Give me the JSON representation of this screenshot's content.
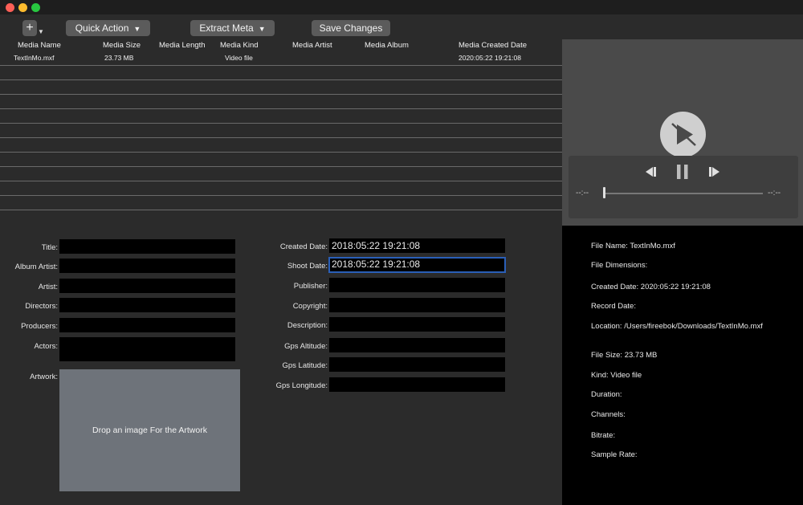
{
  "toolbar": {
    "add_label": "+",
    "quick_action": "Quick Action",
    "extract_meta": "Extract Meta",
    "save_changes": "Save Changes"
  },
  "table": {
    "columns": [
      "Media Name",
      "Media Size",
      "Media Length",
      "Media Kind",
      "Media Artist",
      "Media Album",
      "Media Created Date"
    ],
    "rows": [
      {
        "name": "TextInMo.mxf",
        "size": "23.73 MB",
        "length": "",
        "kind": "Video file",
        "artist": "",
        "album": "",
        "created": "2020:05:22 19:21:08"
      }
    ]
  },
  "player": {
    "time_elapsed": "--:--",
    "time_remaining": "--:--",
    "progress": 0
  },
  "form": {
    "title_label": "Title:",
    "album_artist_label": "Album Artist:",
    "artist_label": "Artist:",
    "directors_label": "Directors:",
    "producers_label": "Producers:",
    "actors_label": "Actors:",
    "artwork_label": "Artwork:",
    "artwork_hint": "Drop an image For the Artwork",
    "created_date_label": "Created Date:",
    "created_date_value": "2018:05:22 19:21:08",
    "shoot_date_label": "Shoot Date:",
    "shoot_date_value": "2018:05:22 19:21:08",
    "publisher_label": "Publisher:",
    "copyright_label": "Copyright:",
    "description_label": "Description:",
    "gps_altitude_label": "Gps Altitude:",
    "gps_latitude_label": "Gps Latitude:",
    "gps_longitude_label": "Gps Longitude:"
  },
  "info": {
    "file_name": "File Name: TextInMo.mxf",
    "file_dimensions": "File Dimensions:",
    "created_date": "Created Date: 2020:05:22 19:21:08",
    "record_date": "Record Date:",
    "location": "Location: /Users/fireebok/Downloads/TextInMo.mxf",
    "file_size": "File Size: 23.73 MB",
    "kind": "Kind: Video file",
    "duration": "Duration:",
    "channels": "Channels:",
    "bitrate": "Bitrate:",
    "sample_rate": "Sample Rate:"
  },
  "colors": {
    "window_bg": "#2b2b2b",
    "field_bg": "#000000",
    "focus_ring": "#2a5fb8",
    "artwork_bg": "#6e737a",
    "close": "#fe5f57",
    "minimize": "#febc2e",
    "zoom": "#28c840"
  }
}
